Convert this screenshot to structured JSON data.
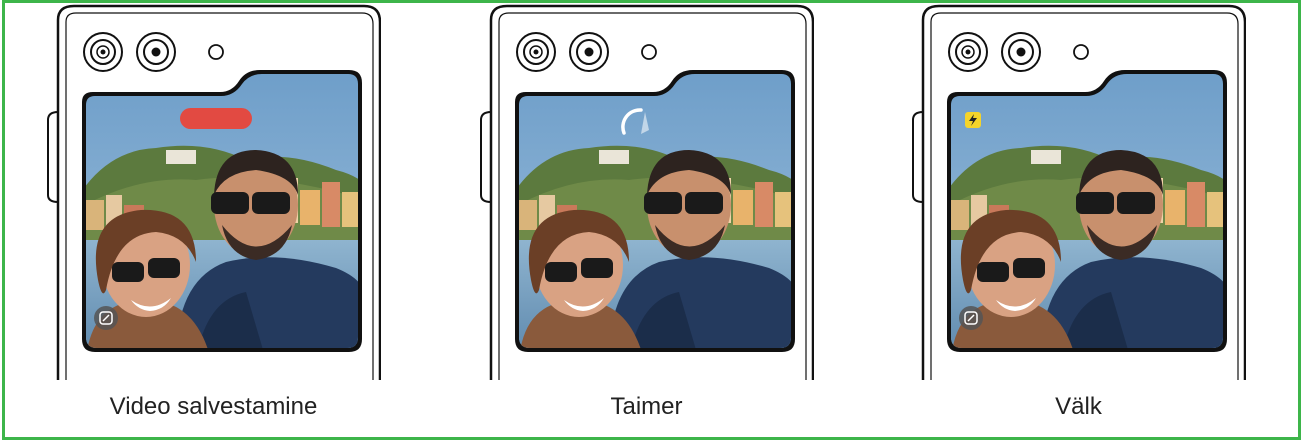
{
  "panels": [
    {
      "caption": "Video salvestamine",
      "indicator": "recording-pill"
    },
    {
      "caption": "Taimer",
      "indicator": "timer-ring"
    },
    {
      "caption": "Välk",
      "indicator": "flash-icon"
    }
  ],
  "colors": {
    "border": "#3db54a",
    "recording": "#e8463a",
    "flash": "#f5d42a",
    "sky": "#7aa6cc"
  }
}
